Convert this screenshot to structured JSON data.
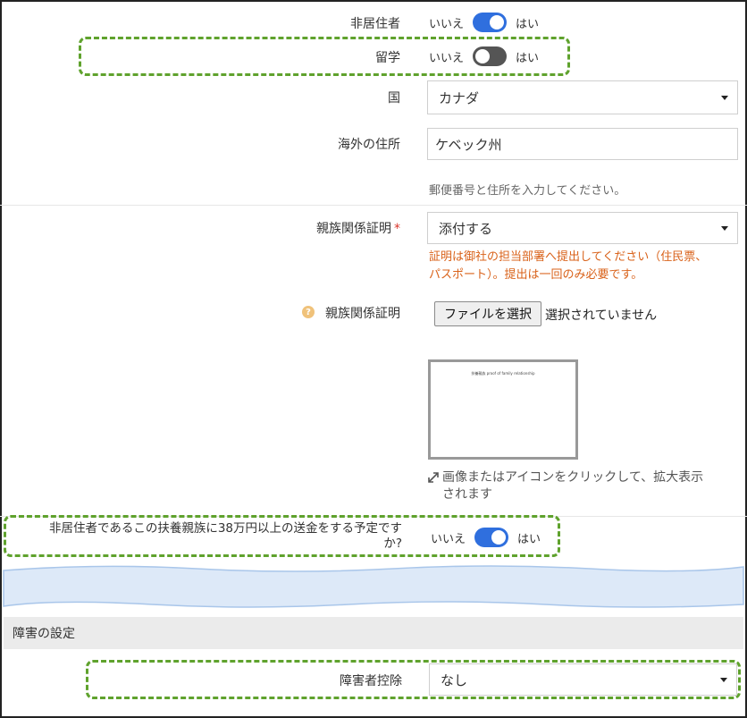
{
  "nonresident": {
    "label": "非居住者",
    "no": "いいえ",
    "yes": "はい",
    "state": "on"
  },
  "study_abroad": {
    "label": "留学",
    "no": "いいえ",
    "yes": "はい",
    "state": "off"
  },
  "country": {
    "label": "国",
    "value": "カナダ"
  },
  "overseas_address": {
    "label": "海外の住所",
    "value": "ケベック州",
    "help": "郵便番号と住所を入力してください。"
  },
  "relationship_proof": {
    "label": "親族関係証明",
    "required_mark": "*",
    "value": "添付する",
    "notice_line1": "証明は御社の担当部署へ提出してください（住民票、",
    "notice_line2": "パスポート）。提出は一回のみ必要です。"
  },
  "relationship_file": {
    "help_icon": "question-circle-icon",
    "label": "親族関係証明",
    "button": "ファイルを選択",
    "status": "選択されていません",
    "thumb_text": "扶養親族   proof of family relationship",
    "expand_hint_line1": "画像またはアイコンをクリックして、拡大表示",
    "expand_hint_line2": "されます"
  },
  "remittance": {
    "label_line1": "非居住者であるこの扶養親族に38万円以上の送金をする予定です",
    "label_line2": "か?",
    "no": "いいえ",
    "yes": "はい",
    "state": "on"
  },
  "disability_section": {
    "title": "障害の設定"
  },
  "disability_deduction": {
    "label": "障害者控除",
    "value": "なし"
  },
  "colors": {
    "toggle_on": "#2f6fde",
    "toggle_off": "#555555",
    "highlight_dash": "#5fa22d",
    "warning_text": "#d9621a"
  }
}
